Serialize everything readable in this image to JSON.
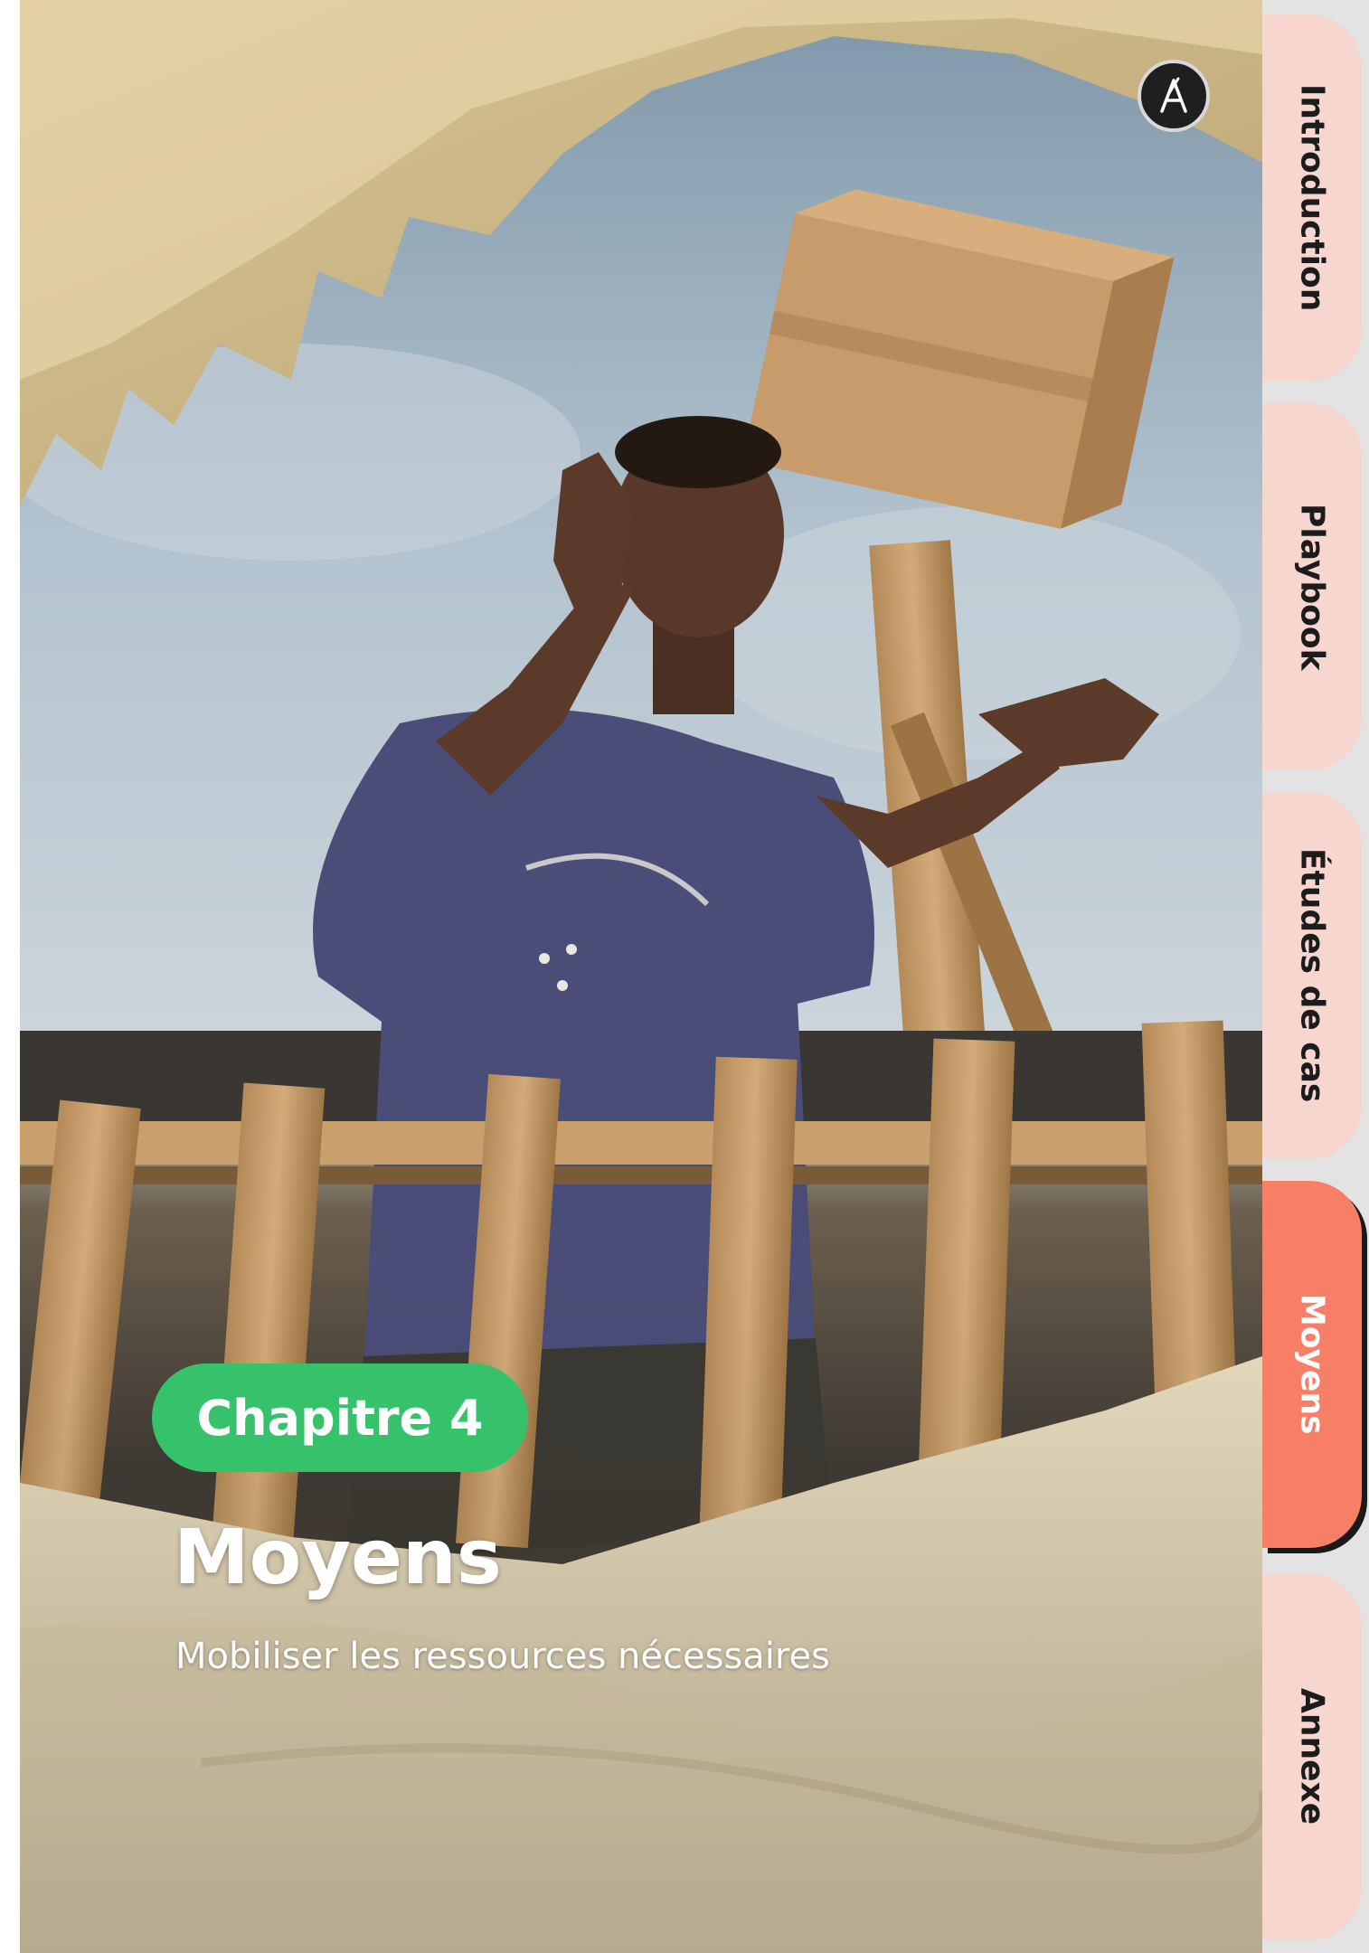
{
  "hero": {
    "logo_icon": "compass-a-logo-icon",
    "chapter_badge": "Chapitre 4",
    "title": "Moyens",
    "subtitle": "Mobiliser les ressources nécessaires",
    "badge_color": "#35c26a"
  },
  "tabs": [
    {
      "label": "Introduction",
      "active": false
    },
    {
      "label": "Playbook",
      "active": false
    },
    {
      "label": "Études de cas",
      "active": false
    },
    {
      "label": "Moyens",
      "active": true
    },
    {
      "label": "Annexe",
      "active": false
    }
  ],
  "colors": {
    "tab_inactive": "#f6d6cf",
    "tab_active": "#f77f66",
    "rail": "#e3e3e3"
  }
}
